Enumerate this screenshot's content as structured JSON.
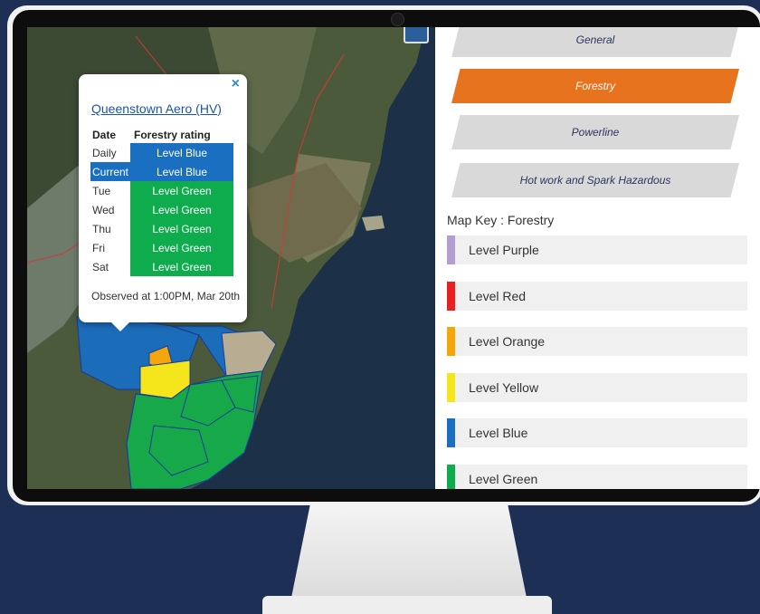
{
  "popup": {
    "close_icon": "×",
    "station": "Queenstown Aero (HV)",
    "header_date": "Date",
    "header_rating": "Forestry rating",
    "rows": [
      {
        "date": "Daily",
        "rating": "Level Blue",
        "color": "#1a6fc0"
      },
      {
        "date": "Current",
        "rating": "Level Blue",
        "color": "#1a6fc0"
      },
      {
        "date": "Tue",
        "rating": "Level Green",
        "color": "#0fac4e"
      },
      {
        "date": "Wed",
        "rating": "Level Green",
        "color": "#0fac4e"
      },
      {
        "date": "Thu",
        "rating": "Level Green",
        "color": "#0fac4e"
      },
      {
        "date": "Fri",
        "rating": "Level Green",
        "color": "#0fac4e"
      },
      {
        "date": "Sat",
        "rating": "Level Green",
        "color": "#0fac4e"
      }
    ],
    "observed": "Observed at 1:00PM, Mar 20th"
  },
  "tabs": [
    {
      "label": "General",
      "active": false
    },
    {
      "label": "Forestry",
      "active": true
    },
    {
      "label": "Powerline",
      "active": false
    },
    {
      "label": "Hot work and Spark Hazardous",
      "active": false
    }
  ],
  "map_key": {
    "title": "Map Key : Forestry",
    "items": [
      {
        "label": "Level Purple",
        "color": "#b39ecf"
      },
      {
        "label": "Level Red",
        "color": "#e8201f"
      },
      {
        "label": "Level Orange",
        "color": "#f4a60b"
      },
      {
        "label": "Level Yellow",
        "color": "#f5e61c"
      },
      {
        "label": "Level Blue",
        "color": "#1a6fc0"
      },
      {
        "label": "Level Green",
        "color": "#0fac4e"
      }
    ]
  }
}
